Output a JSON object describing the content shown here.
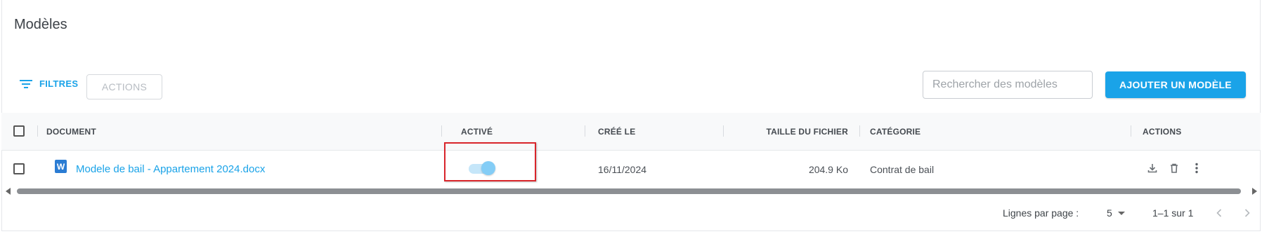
{
  "page": {
    "title": "Modèles"
  },
  "toolbar": {
    "filters_label": "FILTRES",
    "actions_label": "ACTIONS",
    "search_placeholder": "Rechercher des modèles",
    "add_label": "AJOUTER UN MODÈLE"
  },
  "table": {
    "columns": {
      "document": "DOCUMENT",
      "active": "ACTIVÉ",
      "created": "CRÉÉ LE",
      "size": "TAILLE DU FICHIER",
      "category": "CATÉGORIE",
      "actions": "ACTIONS"
    },
    "rows": [
      {
        "file_icon": "W",
        "document": "Modele de bail - Appartement 2024.docx",
        "active": true,
        "created": "16/11/2024",
        "size": "204.9 Ko",
        "category": "Contrat de bail"
      }
    ]
  },
  "pagination": {
    "rows_per_page_label": "Lignes par page :",
    "rows_per_page_value": "5",
    "range": "1–1 sur 1"
  },
  "colors": {
    "accent": "#1aa3e8",
    "highlight": "#d9252b",
    "word_blue": "#2b7cd3"
  },
  "icons": [
    "filter-icon",
    "word-file-icon",
    "download-icon",
    "trash-icon",
    "more-vertical-icon",
    "chevron-left-icon",
    "chevron-right-icon",
    "caret-down-icon"
  ]
}
